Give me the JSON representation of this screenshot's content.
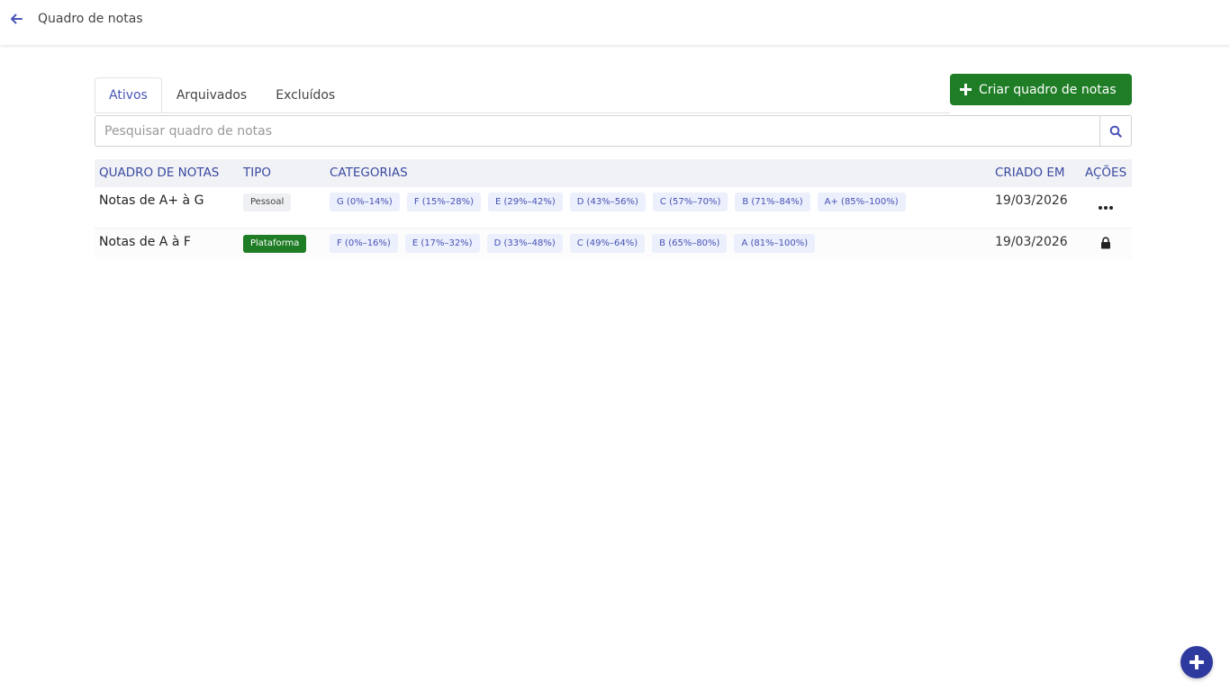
{
  "header": {
    "title": "Quadro de notas",
    "back_icon": "arrow-left-icon"
  },
  "tabs": [
    {
      "label": "Ativos",
      "active": true
    },
    {
      "label": "Arquivados",
      "active": false
    },
    {
      "label": "Excluídos",
      "active": false
    }
  ],
  "create_button": {
    "label": "Criar quadro de notas",
    "icon": "plus-icon",
    "color": "#1f7d26"
  },
  "search": {
    "placeholder": "Pesquisar quadro de notas",
    "value": "",
    "icon": "search-icon"
  },
  "table": {
    "columns": [
      "QUADRO DE NOTAS",
      "TIPO",
      "CATEGORIAS",
      "CRIADO EM",
      "AÇÕES"
    ],
    "rows": [
      {
        "name": "Notas de A+ à G",
        "type": "Pessoal",
        "categories": [
          "G (0%–14%)",
          "F (15%–28%)",
          "E (29%–42%)",
          "D (43%–56%)",
          "C (57%–70%)",
          "B (71%–84%)",
          "A+ (85%–100%)"
        ],
        "created": "19/03/2026",
        "action_icon": "more-options-icon"
      },
      {
        "name": "Notas de A à F",
        "type": "Plataforma",
        "categories": [
          "F (0%–16%)",
          "E (17%–32%)",
          "D (33%–48%)",
          "C (49%–64%)",
          "B (65%–80%)",
          "A (81%–100%)"
        ],
        "created": "19/03/2026",
        "action_icon": "lock-icon"
      }
    ]
  },
  "fab": {
    "icon": "plus-icon",
    "color": "#2f3a9e"
  },
  "colors": {
    "accent": "#4a55b8",
    "primary_green": "#1f7d26",
    "header_text": "#3b4aa0"
  }
}
